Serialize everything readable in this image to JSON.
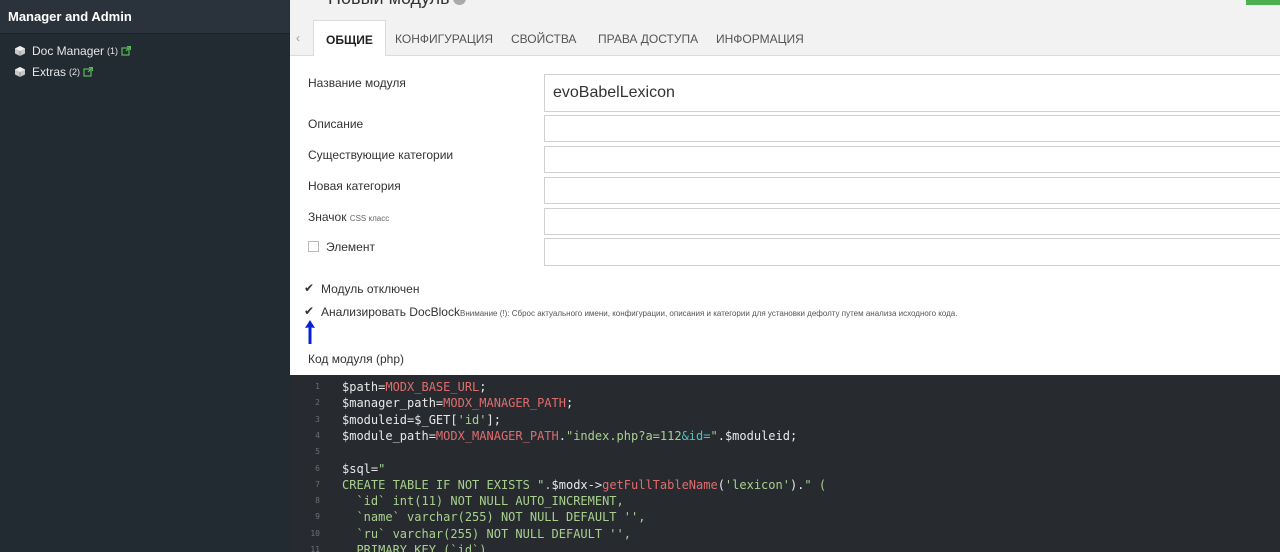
{
  "sidebar": {
    "header": "Manager and Admin",
    "items": [
      {
        "label": "Doc Manager",
        "count": "(1)"
      },
      {
        "label": "Extras",
        "count": "(2)"
      }
    ]
  },
  "page": {
    "title": "Новый модуль"
  },
  "tabs": [
    {
      "label": "ОБЩИЕ"
    },
    {
      "label": "КОНФИГУРАЦИЯ"
    },
    {
      "label": "СВОЙСТВА"
    },
    {
      "label": "ПРАВА ДОСТУПА"
    },
    {
      "label": "ИНФОРМАЦИЯ"
    }
  ],
  "form": {
    "name_label": "Название модуля",
    "name_value": "evoBabelLexicon",
    "description_label": "Описание",
    "existing_categories_label": "Существующие категории",
    "new_category_label": "Новая категория",
    "icon_label": "Значок",
    "icon_sublabel": "CSS класс",
    "element_label": "Элемент",
    "disabled_label": "Модуль отключен",
    "docblock_label": "Анализировать DocBlock",
    "docblock_warning": "Внимание (!): Сброс актуального имени, конфигурации, описания и категории для установки дефолту путем анализа исходного кода.",
    "code_label": "Код модуля (php)"
  },
  "code_lines": [
    {
      "n": "1",
      "parts": [
        [
          "$path=",
          "plain"
        ],
        [
          "MODX_BASE_URL",
          "red"
        ],
        [
          ";",
          "plain"
        ]
      ]
    },
    {
      "n": "2",
      "parts": [
        [
          "$manager_path=",
          "plain"
        ],
        [
          "MODX_MANAGER_PATH",
          "red"
        ],
        [
          ";",
          "plain"
        ]
      ]
    },
    {
      "n": "3",
      "parts": [
        [
          "$moduleid=$_GET[",
          "plain"
        ],
        [
          "'id'",
          "green"
        ],
        [
          "];",
          "plain"
        ]
      ]
    },
    {
      "n": "4",
      "parts": [
        [
          "$module_path=",
          "plain"
        ],
        [
          "MODX_MANAGER_PATH",
          "red"
        ],
        [
          ".",
          "plain"
        ],
        [
          "\"index.php?a=112",
          "green"
        ],
        [
          "&id=",
          "teal"
        ],
        [
          "\"",
          "green"
        ],
        [
          ".$moduleid;",
          "plain"
        ]
      ]
    },
    {
      "n": "5",
      "parts": []
    },
    {
      "n": "6",
      "parts": [
        [
          "$sql=",
          "plain"
        ],
        [
          "\"",
          "green"
        ]
      ]
    },
    {
      "n": "7",
      "parts": [
        [
          "CREATE TABLE IF NOT EXISTS \".",
          "green"
        ],
        [
          "$modx->",
          "plain"
        ],
        [
          "getFullTableName",
          "red"
        ],
        [
          "(",
          "plain"
        ],
        [
          "'lexicon'",
          "green"
        ],
        [
          ").",
          "plain"
        ],
        [
          "\" (",
          "green"
        ]
      ]
    },
    {
      "n": "8",
      "parts": [
        [
          "  `id` int(11) NOT NULL AUTO_INCREMENT,",
          "green"
        ]
      ]
    },
    {
      "n": "9",
      "parts": [
        [
          "  `name` varchar(255) NOT NULL DEFAULT '',",
          "green"
        ]
      ]
    },
    {
      "n": "10",
      "parts": [
        [
          "  `ru` varchar(255) NOT NULL DEFAULT '',",
          "green"
        ]
      ]
    },
    {
      "n": "11",
      "parts": [
        [
          "  PRIMARY KEY (`id`)",
          "green"
        ]
      ]
    }
  ]
}
